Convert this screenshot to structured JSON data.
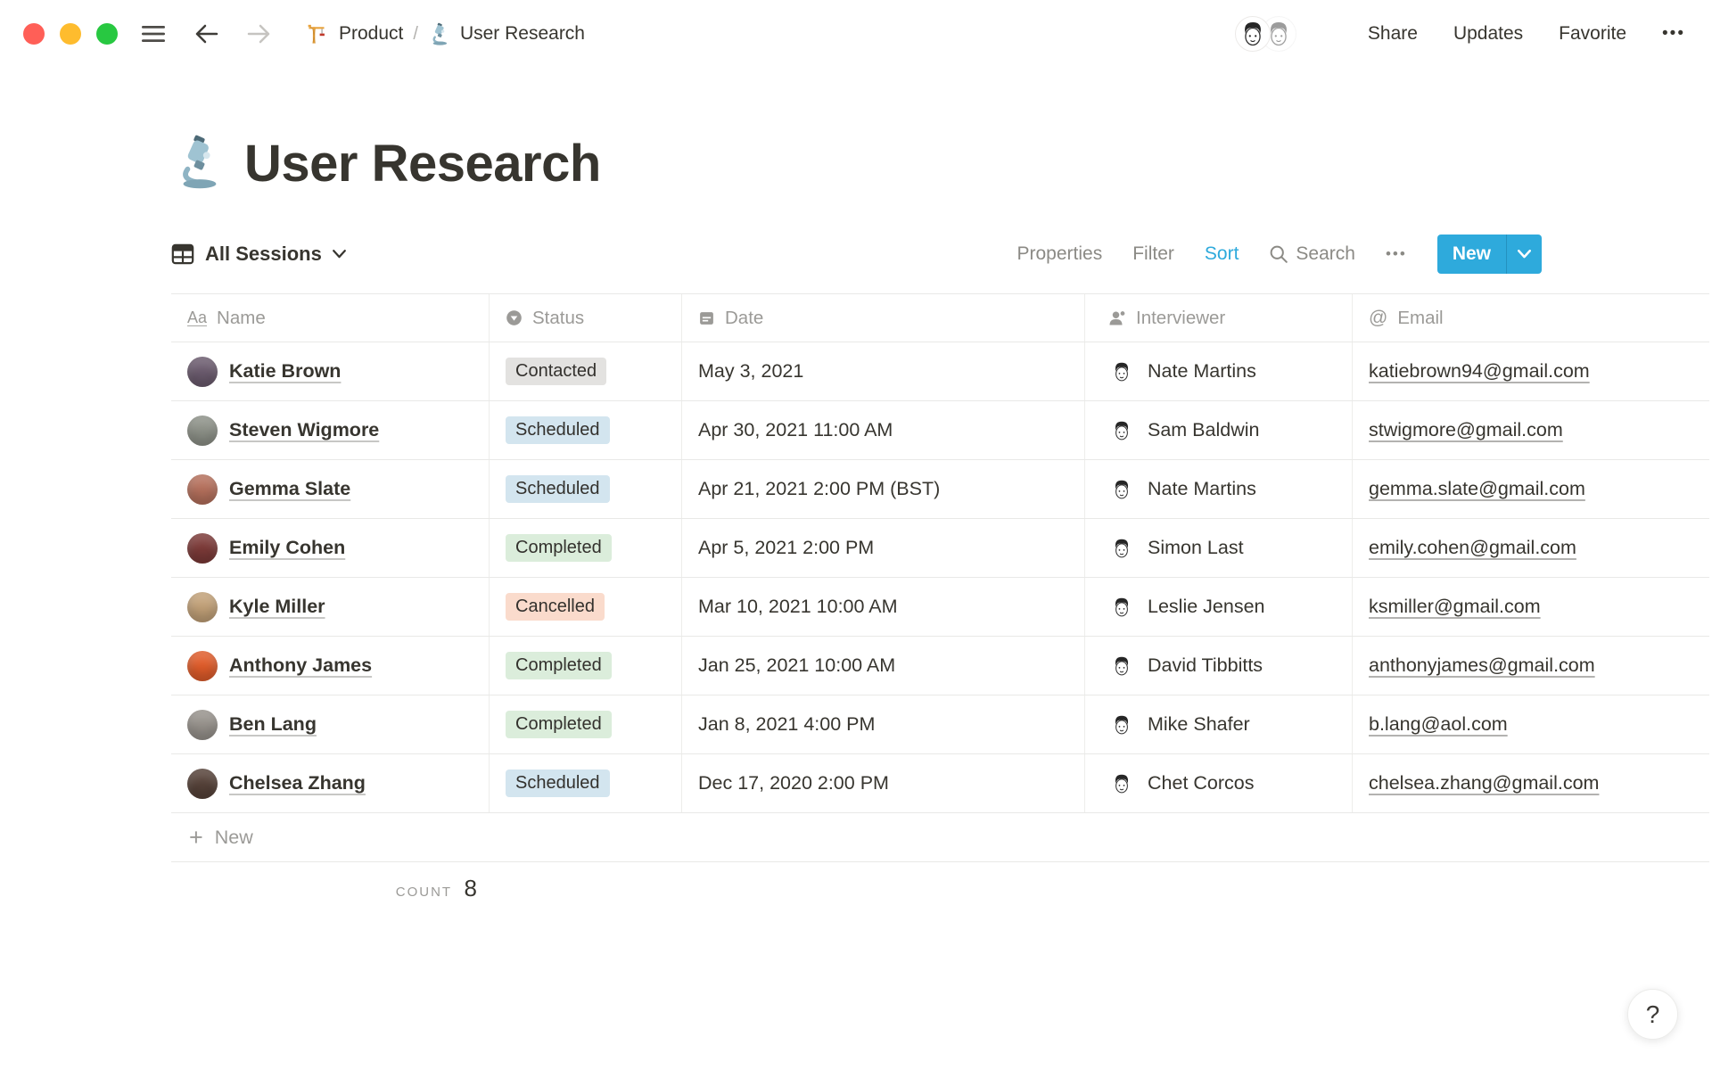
{
  "window": {
    "traffic_lights": {
      "close": "#ff5f57",
      "minimize": "#febc2e",
      "zoom": "#28c841"
    }
  },
  "topbar": {
    "breadcrumb": {
      "parent": "Product",
      "separator": "/",
      "current": "User Research"
    },
    "share": "Share",
    "updates": "Updates",
    "favorite": "Favorite",
    "more": "•••"
  },
  "page": {
    "title": "User Research"
  },
  "toolbar": {
    "view_label": "All Sessions",
    "properties": "Properties",
    "filter": "Filter",
    "sort": "Sort",
    "search": "Search",
    "more": "•••",
    "new_label": "New",
    "accent_color": "#2eaadc",
    "sort_color": "#2eaadc"
  },
  "icons": {
    "name_type": "Aa",
    "email_type": "@",
    "plus": "+"
  },
  "table": {
    "columns": [
      "Name",
      "Status",
      "Date",
      "Interviewer",
      "Email"
    ],
    "rows": [
      {
        "name": "Katie Brown",
        "avatar_color": "#6b5b6e",
        "status": "Contacted",
        "status_bg": "#e3e2e0",
        "date": "May 3, 2021",
        "interviewer": "Nate Martins",
        "email": "katiebrown94@gmail.com"
      },
      {
        "name": "Steven Wigmore",
        "avatar_color": "#8d9188",
        "status": "Scheduled",
        "status_bg": "#d3e5ef",
        "date": "Apr 30, 2021 11:00 AM",
        "interviewer": "Sam Baldwin",
        "email": "stwigmore@gmail.com"
      },
      {
        "name": "Gemma Slate",
        "avatar_color": "#b5705c",
        "status": "Scheduled",
        "status_bg": "#d3e5ef",
        "date": "Apr 21, 2021 2:00 PM (BST)",
        "interviewer": "Nate Martins",
        "email": "gemma.slate@gmail.com"
      },
      {
        "name": "Emily Cohen",
        "avatar_color": "#7c3a38",
        "status": "Completed",
        "status_bg": "#dbeddb",
        "date": "Apr 5, 2021 2:00 PM",
        "interviewer": "Simon Last",
        "email": "emily.cohen@gmail.com"
      },
      {
        "name": "Kyle Miller",
        "avatar_color": "#c2a178",
        "status": "Cancelled",
        "status_bg": "#fadbcc",
        "date": "Mar 10, 2021 10:00 AM",
        "interviewer": "Leslie Jensen",
        "email": "ksmiller@gmail.com"
      },
      {
        "name": "Anthony James",
        "avatar_color": "#e05c2a",
        "status": "Completed",
        "status_bg": "#dbeddb",
        "date": "Jan 25, 2021 10:00 AM",
        "interviewer": "David Tibbitts",
        "email": "anthonyjames@gmail.com"
      },
      {
        "name": "Ben Lang",
        "avatar_color": "#97928c",
        "status": "Completed",
        "status_bg": "#dbeddb",
        "date": "Jan 8, 2021 4:00 PM",
        "interviewer": "Mike Shafer",
        "email": "b.lang@aol.com"
      },
      {
        "name": "Chelsea Zhang",
        "avatar_color": "#564239",
        "status": "Scheduled",
        "status_bg": "#d3e5ef",
        "date": "Dec 17, 2020 2:00 PM",
        "interviewer": "Chet Corcos",
        "email": "chelsea.zhang@gmail.com"
      }
    ],
    "new_row_label": "New",
    "count_label": "COUNT",
    "count_value": "8"
  },
  "help": {
    "label": "?"
  }
}
